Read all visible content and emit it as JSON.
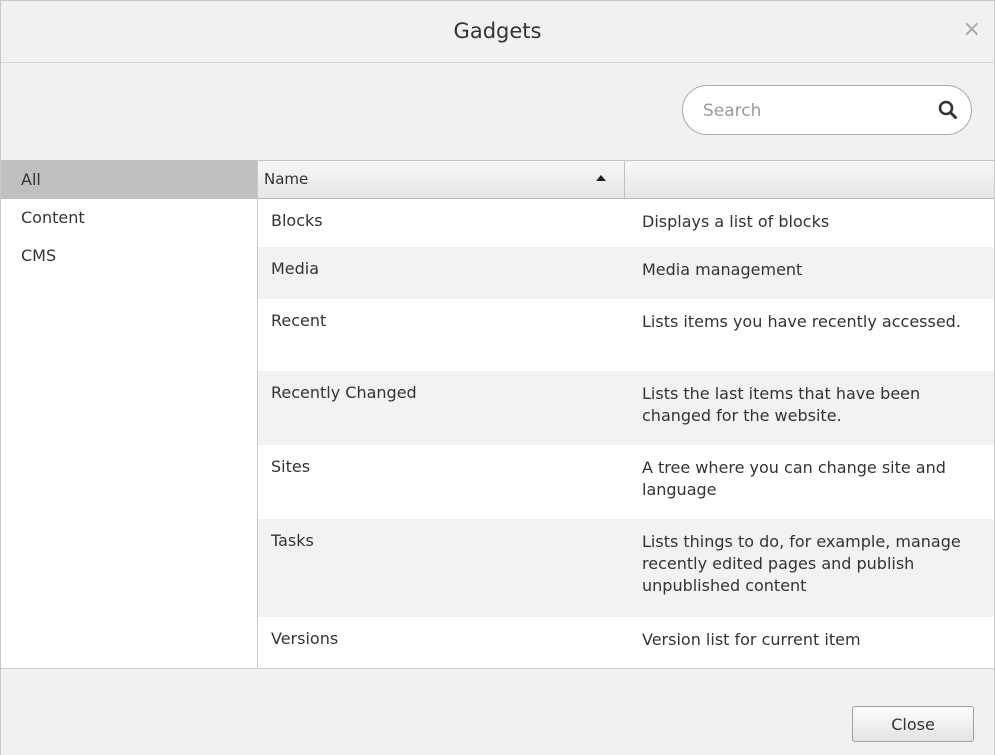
{
  "dialog": {
    "title": "Gadgets",
    "close_glyph": "×"
  },
  "search": {
    "placeholder": "Search",
    "value": ""
  },
  "sidebar": {
    "items": [
      {
        "label": "All",
        "selected": true
      },
      {
        "label": "Content",
        "selected": false
      },
      {
        "label": "CMS",
        "selected": false
      }
    ]
  },
  "grid": {
    "columns": [
      {
        "label": "Name",
        "sort": "ascending"
      },
      {
        "label": ""
      }
    ],
    "rows": [
      {
        "name": "Blocks",
        "description": "Displays a list of blocks"
      },
      {
        "name": "Media",
        "description": "Media management"
      },
      {
        "name": "Recent",
        "description": "Lists items you have recently accessed."
      },
      {
        "name": "Recently Changed",
        "description": "Lists the last items that have been changed for the website."
      },
      {
        "name": "Sites",
        "description": "A tree where you can change site and language"
      },
      {
        "name": "Tasks",
        "description": "Lists things to do, for example, manage recently edited pages and publish unpublished content"
      },
      {
        "name": "Versions",
        "description": "Version list for current item"
      }
    ]
  },
  "footer": {
    "close_label": "Close"
  },
  "icons": {
    "search": "search-icon",
    "close": "close-icon",
    "sort": "sort-ascending-icon"
  }
}
